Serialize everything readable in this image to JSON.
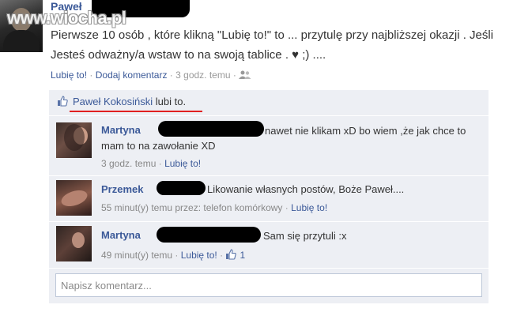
{
  "watermark": "www.wiocha.pl",
  "post": {
    "author": "Paweł",
    "text": "Pierwsze 10 osób , które klikną \"Lubię to!\" to ... przytulę przy najbliższej okazji . Jeśli Jesteś odważny/a wstaw to na swoją tablice . ♥ ;) ....",
    "like_label": "Lubię to!",
    "comment_label": "Dodaj komentarz",
    "time": "3 godz. temu",
    "separator": "·"
  },
  "likes": {
    "name": "Paweł Kokosiński",
    "suffix": "lubi to."
  },
  "comments": [
    {
      "author": "Martyna",
      "text": "nawet nie klikam xD bo wiem ,że jak chce to mam to na zawołanie XD",
      "time": "3 godz. temu",
      "like_label": "Lubię to!"
    },
    {
      "author": "Przemek",
      "text": "Likowanie własnych postów, Boże Paweł....",
      "time": "55 minut(y) temu przez: telefon komórkowy",
      "like_label": "Lubię to!"
    },
    {
      "author": "Martyna",
      "text": "Sam się przytuli :x",
      "time": "49 minut(y) temu",
      "like_label": "Lubię to!",
      "like_count": "1"
    }
  ],
  "comment_input": {
    "placeholder": "Napisz komentarz..."
  },
  "colors": {
    "link": "#3b5998",
    "comment_bg": "#edeff4",
    "underline": "#e02020"
  }
}
